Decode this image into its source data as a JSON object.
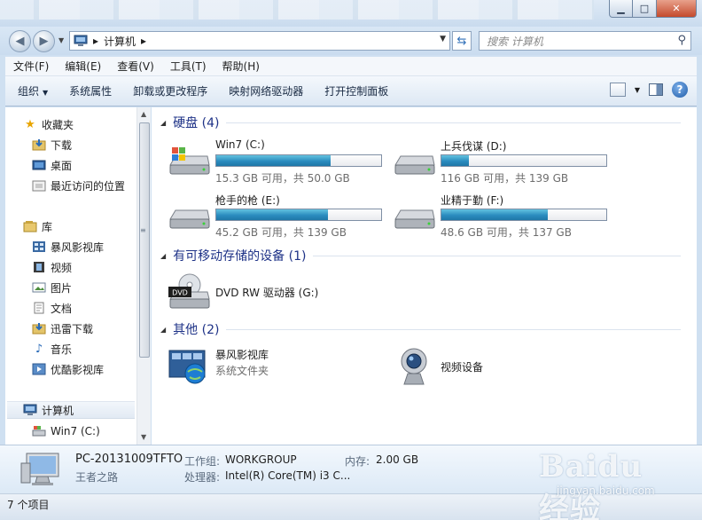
{
  "window": {
    "minimize_glyph": "▁",
    "maximize_glyph": "□",
    "close_glyph": "✕"
  },
  "address": {
    "crumb_separator": "▸",
    "location": "计算机",
    "search_placeholder": "搜索 计算机"
  },
  "menu": [
    "文件(F)",
    "编辑(E)",
    "查看(V)",
    "工具(T)",
    "帮助(H)"
  ],
  "toolbar": {
    "organize": "组织",
    "system_properties": "系统属性",
    "uninstall": "卸载或更改程序",
    "map_drive": "映射网络驱动器",
    "control_panel": "打开控制面板",
    "help_glyph": "?"
  },
  "sidebar": {
    "favorites": "收藏夹",
    "downloads": "下载",
    "desktop": "桌面",
    "recent": "最近访问的位置",
    "libraries": "库",
    "baofeng": "暴风影视库",
    "videos": "视频",
    "pictures": "图片",
    "documents": "文档",
    "xunlei": "迅雷下载",
    "music": "音乐",
    "youku": "优酷影视库",
    "computer": "计算机",
    "win7c": "Win7 (C:)"
  },
  "groups": {
    "hdd": "硬盘 (4)",
    "removable": "有可移动存储的设备 (1)",
    "other": "其他 (2)"
  },
  "drives": [
    {
      "name": "Win7 (C:)",
      "info": "15.3 GB 可用，共 50.0 GB",
      "used_fraction": 0.694
    },
    {
      "name": "上兵伐谋 (D:)",
      "info": "116 GB 可用，共 139 GB",
      "used_fraction": 0.165
    },
    {
      "name": "枪手的枪 (E:)",
      "info": "45.2 GB 可用，共 139 GB",
      "used_fraction": 0.675
    },
    {
      "name": "业精于勤 (F:)",
      "info": "48.6 GB 可用，共 137 GB",
      "used_fraction": 0.645
    }
  ],
  "dvd": {
    "name": "DVD RW 驱动器 (G:)",
    "badge": "DVD"
  },
  "others": {
    "baofeng_name": "暴风影视库",
    "baofeng_type": "系统文件夹",
    "webcam_name": "视频设备"
  },
  "details": {
    "pc_name": "PC-20131009TFTO",
    "user": "王者之路",
    "workgroup_label": "工作组:",
    "workgroup": "WORKGROUP",
    "memory_label": "内存:",
    "memory": "2.00 GB",
    "cpu_label": "处理器:",
    "cpu": "Intel(R) Core(TM) i3 C..."
  },
  "status": {
    "items": "7 个项目"
  },
  "watermark": {
    "brand": "Baidu经验",
    "url": "jingyan.baidu.com"
  }
}
